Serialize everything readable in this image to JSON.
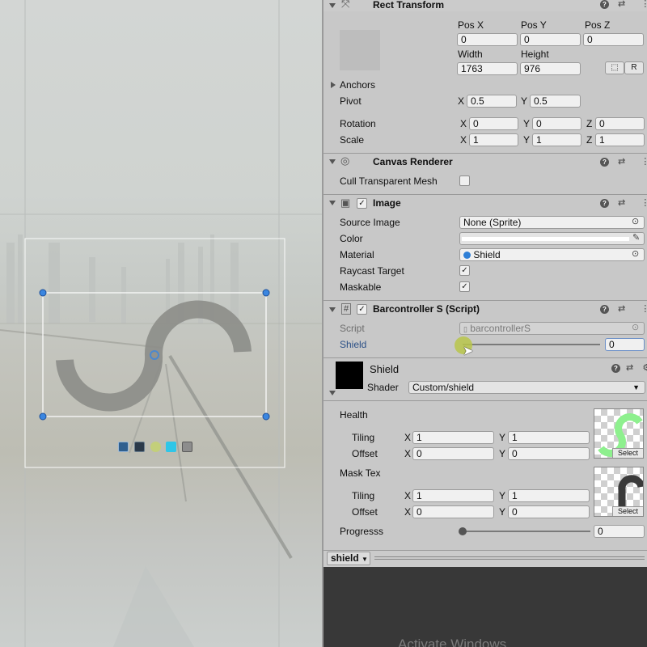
{
  "rect_transform": {
    "title": "Rect Transform",
    "pos_x_label": "Pos X",
    "pos_y_label": "Pos Y",
    "pos_z_label": "Pos Z",
    "pos_x": "0",
    "pos_y": "0",
    "pos_z": "0",
    "width_label": "Width",
    "height_label": "Height",
    "width": "1763",
    "height": "976",
    "r_button": "R",
    "anchors_label": "Anchors",
    "pivot_label": "Pivot",
    "pivot_x": "0.5",
    "pivot_y": "0.5",
    "rotation_label": "Rotation",
    "rot_x": "0",
    "rot_y": "0",
    "rot_z": "0",
    "scale_label": "Scale",
    "scale_x": "1",
    "scale_y": "1",
    "scale_z": "1",
    "x": "X",
    "y": "Y",
    "z": "Z"
  },
  "canvas_renderer": {
    "title": "Canvas Renderer",
    "cull_label": "Cull Transparent Mesh",
    "cull_checked": false
  },
  "image": {
    "title": "Image",
    "source_image_label": "Source Image",
    "source_image_value": "None (Sprite)",
    "color_label": "Color",
    "color_value": "#ffffff",
    "material_label": "Material",
    "material_value": "Shield",
    "raycast_label": "Raycast Target",
    "raycast_checked": true,
    "maskable_label": "Maskable",
    "maskable_checked": true,
    "check_mark": "✓"
  },
  "barcontroller": {
    "title": "Barcontroller S (Script)",
    "script_label": "Script",
    "script_value": "barcontrollerS",
    "shield_label": "Shield",
    "shield_value": "0"
  },
  "material": {
    "name": "Shield",
    "shader_label": "Shader",
    "shader_value": "Custom/shield",
    "health_label": "Health",
    "tiling_label": "Tiling",
    "offset_label": "Offset",
    "health_tiling_x": "1",
    "health_tiling_y": "1",
    "health_offset_x": "0",
    "health_offset_y": "0",
    "mask_label": "Mask Tex",
    "mask_tiling_x": "1",
    "mask_tiling_y": "1",
    "mask_offset_x": "0",
    "mask_offset_y": "0",
    "select_label": "Select",
    "progress_label": "Progresss",
    "progress_value": "0"
  },
  "preview": {
    "dropdown_label": "shield"
  },
  "watermark": "Activate Windows",
  "colors": {
    "inspector_bg": "#c8c8c8",
    "slider_handle": "#b9c64a",
    "health_tex": "#8ef08e"
  }
}
